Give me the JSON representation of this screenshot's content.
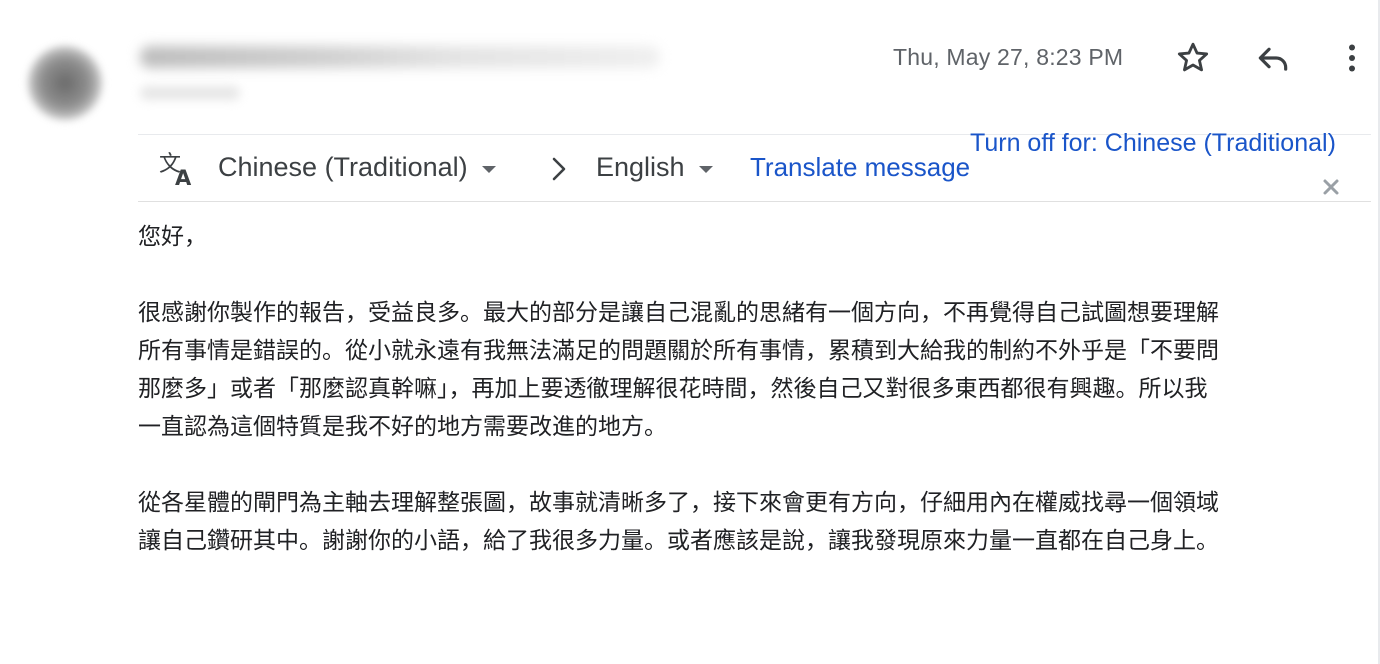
{
  "header": {
    "timestamp": "Thu, May 27, 8:23 PM",
    "icons": {
      "star": "star-outline-icon",
      "reply": "reply-arrow-icon",
      "more": "more-vertical-icon"
    }
  },
  "translate_bar": {
    "icon": "translate-icon",
    "source_language": "Chinese (Traditional)",
    "target_language": "English",
    "translate_label": "Translate message",
    "turn_off_label": "Turn off for: Chinese (Traditional)"
  },
  "message": {
    "greeting": "您好，",
    "paragraphs": [
      "很感謝你製作的報告，受益良多。最大的部分是讓自己混亂的思緒有一個方向，不再覺得自己試圖想要理解\n所有事情是錯誤的。從小就永遠有我無法滿足的問題關於所有事情，累積到大給我的制約不外乎是「不要問\n那麼多」或者「那麼認真幹嘛」，再加上要透徹理解很花時間，然後自己又對很多東西都很有興趣。所以我\n一直認為這個特質是我不好的地方需要改進的地方。",
      "從各星體的閘門為主軸去理解整張圖，故事就清晰多了，接下來會更有方向，仔細用內在權威找尋一個領域\n讓自己鑽研其中。謝謝你的小語，給了我很多力量。或者應該是說，讓我發現原來力量一直都在自己身上。"
    ]
  },
  "colors": {
    "link": "#1a55c9",
    "secondary_text": "#5f6368",
    "body_text": "#202124"
  }
}
